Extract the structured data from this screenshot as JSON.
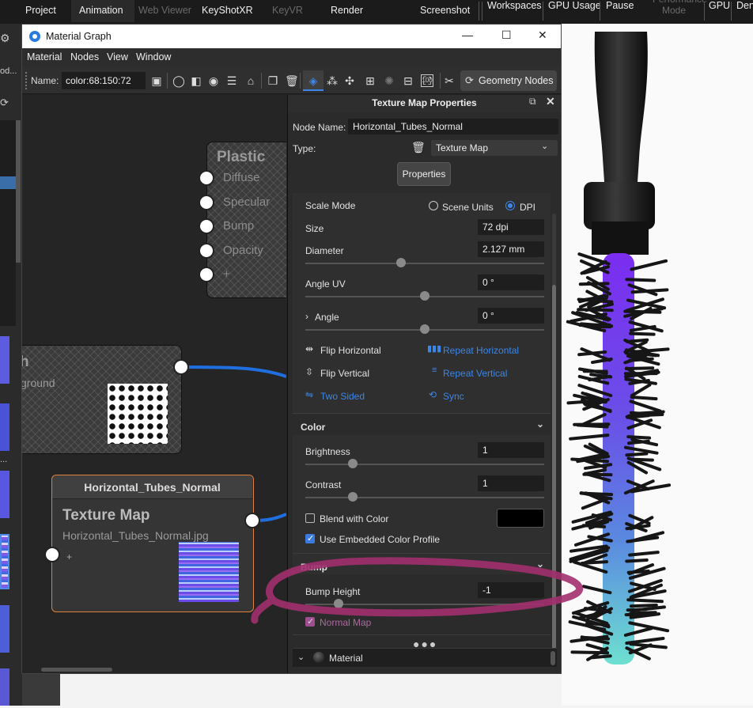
{
  "topbar": {
    "items": [
      "Project",
      "Animation",
      "Web Viewer",
      "KeyShotXR",
      "KeyVR",
      "Render",
      "Screenshot",
      "Workspaces",
      "GPU Usage",
      "Pause",
      "Performance Mode",
      "GPU",
      "Den"
    ]
  },
  "left_strip": {
    "label_fragments": [
      "od...",
      "..."
    ]
  },
  "window": {
    "title": "Material Graph",
    "minimize_glyph": "—",
    "maximize_glyph": "☐",
    "close_glyph": "✕",
    "menu": [
      "Material",
      "Nodes",
      "View",
      "Window"
    ],
    "toolbar": {
      "name_label": "Name:",
      "name_value": "color:68:150:72",
      "geometry_nodes_label": "Geometry Nodes"
    }
  },
  "graph": {
    "plastic_node": {
      "title": "Plastic",
      "ports": [
        "Diffuse",
        "Specular",
        "Bump",
        "Opacity",
        "+"
      ]
    },
    "upper_node": {
      "title_fragment": "h",
      "subtitle_fragment": "ground"
    },
    "texture_node": {
      "header": "Horizontal_Tubes_Normal",
      "title": "Texture Map",
      "filename": "Horizontal_Tubes_Normal.jpg",
      "input_port": "+"
    }
  },
  "panel": {
    "title": "Texture Map Properties",
    "node_name_label": "Node Name:",
    "node_name_value": "Horizontal_Tubes_Normal",
    "type_label": "Type:",
    "type_value": "Texture Map",
    "properties_button": "Properties",
    "scale_mode_label": "Scale Mode",
    "scale_mode_options": [
      "Scene Units",
      "DPI"
    ],
    "scale_mode_selected": "DPI",
    "size_label": "Size",
    "size_value": "72 dpi",
    "diameter_label": "Diameter",
    "diameter_value": "2.127 mm",
    "diameter_slider": 0.4,
    "angle_uv_label": "Angle UV",
    "angle_uv_value": "0 °",
    "angle_uv_slider": 0.5,
    "angle_label": "Angle",
    "angle_value": "0 °",
    "angle_slider": 0.5,
    "flip_horizontal": "Flip Horizontal",
    "repeat_horizontal": "Repeat Horizontal",
    "flip_vertical": "Flip Vertical",
    "repeat_vertical": "Repeat Vertical",
    "two_sided": "Two Sided",
    "sync": "Sync",
    "color_section": "Color",
    "brightness_label": "Brightness",
    "brightness_value": "1",
    "brightness_slider": 0.2,
    "contrast_label": "Contrast",
    "contrast_value": "1",
    "contrast_slider": 0.2,
    "blend_with_color_label": "Blend with Color",
    "blend_with_color_checked": false,
    "blend_color": "#000000",
    "use_embedded_label": "Use Embedded Color Profile",
    "use_embedded_checked": true,
    "bump_section": "Bump",
    "bump_height_label": "Bump Height",
    "bump_height_value": "-1",
    "bump_height_slider": 0.14,
    "normal_map_label": "Normal Map",
    "normal_map_checked": true,
    "footer_material_label": "Material"
  },
  "colors": {
    "accent_blue": "#3b86e8",
    "texture_node_border": "#e0803a",
    "annotation_magenta": "#a2306f",
    "wire_blue": "#1f6fe0"
  }
}
